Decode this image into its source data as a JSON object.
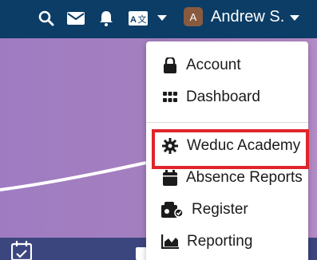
{
  "topbar": {
    "icons": [
      "search-icon",
      "mail-icon",
      "bell-icon",
      "translate-icon",
      "chevron-down-icon"
    ],
    "user": {
      "avatar_letter": "A",
      "name": "Andrew S."
    }
  },
  "dropdown": {
    "items": [
      {
        "label": "Account",
        "icon": "lock-icon"
      },
      {
        "label": "Dashboard",
        "icon": "grid-icon"
      },
      {
        "label": "Weduc Academy",
        "icon": "gear-icon",
        "highlighted": true
      },
      {
        "label": "Absence Reports",
        "icon": "calendar-icon"
      },
      {
        "label": "Register",
        "icon": "register-icon"
      },
      {
        "label": "Reporting",
        "icon": "chart-icon"
      }
    ]
  },
  "colors": {
    "topbar": "#0b3d66",
    "highlight_border": "#e0242b",
    "hero": "#9f7cc2",
    "bottombar": "#3c467e"
  }
}
